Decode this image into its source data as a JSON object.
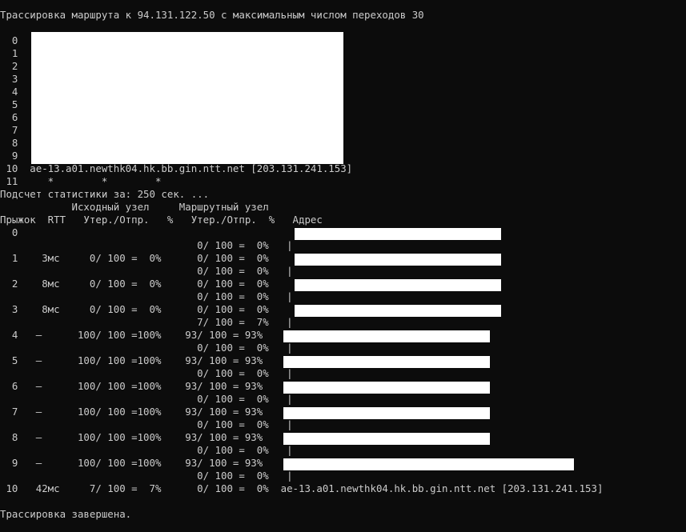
{
  "terminal": {
    "header": "Трассировка маршрута к 94.131.122.50 с максимальным числом переходов 30",
    "trace_rows": [
      {
        "text": "  0"
      },
      {
        "text": "  1"
      },
      {
        "text": "  2"
      },
      {
        "text": "  3"
      },
      {
        "text": "  4"
      },
      {
        "text": "  5"
      },
      {
        "text": "  6"
      },
      {
        "text": "  7"
      },
      {
        "text": "  8"
      },
      {
        "text": "  9"
      },
      {
        "text": " 10  ae-13.a01.newthk04.hk.bb.gin.ntt.net [203.131.241.153]"
      },
      {
        "text": " 11     *        *        *"
      }
    ],
    "stats_title": "Подсчет статистики за: 250 сек. ...",
    "col_header_1": "            Исходный узел     Маршрутный узел",
    "col_header_2": "Прыжок  RTT   Утер./Отпр.   %   Утер./Отпр.  %   Адрес",
    "stat_lines": [
      {
        "text": "  0"
      },
      {
        "text": "                                 0/ 100 =  0%   |"
      },
      {
        "text": "  1    3мс     0/ 100 =  0%      0/ 100 =  0%"
      },
      {
        "text": "                                 0/ 100 =  0%   |"
      },
      {
        "text": "  2    8мс     0/ 100 =  0%      0/ 100 =  0%"
      },
      {
        "text": "                                 0/ 100 =  0%   |"
      },
      {
        "text": "  3    8мс     0/ 100 =  0%      0/ 100 =  0%"
      },
      {
        "text": "                                 7/ 100 =  7%   |"
      },
      {
        "text": "  4   —      100/ 100 =100%    93/ 100 = 93%"
      },
      {
        "text": "                                 0/ 100 =  0%   |"
      },
      {
        "text": "  5   —      100/ 100 =100%    93/ 100 = 93%"
      },
      {
        "text": "                                 0/ 100 =  0%   |"
      },
      {
        "text": "  6   —      100/ 100 =100%    93/ 100 = 93%"
      },
      {
        "text": "                                 0/ 100 =  0%   |"
      },
      {
        "text": "  7   —      100/ 100 =100%    93/ 100 = 93%"
      },
      {
        "text": "                                 0/ 100 =  0%   |"
      },
      {
        "text": "  8   —      100/ 100 =100%    93/ 100 = 93%"
      },
      {
        "text": "                                 0/ 100 =  0%   |"
      },
      {
        "text": "  9   —      100/ 100 =100%    93/ 100 = 93%"
      },
      {
        "text": "                                 0/ 100 =  0%   |"
      },
      {
        "text": " 10   42мс     7/ 100 =  7%      0/ 100 =  0%  ae-13.a01.newthk04.hk.bb.gin.ntt.net [203.131.241.153]"
      }
    ],
    "footer": "Трассировка завершена.",
    "colors": {
      "background": "#0c0c0c",
      "text": "#cccccc",
      "redaction": "#ffffff"
    }
  }
}
